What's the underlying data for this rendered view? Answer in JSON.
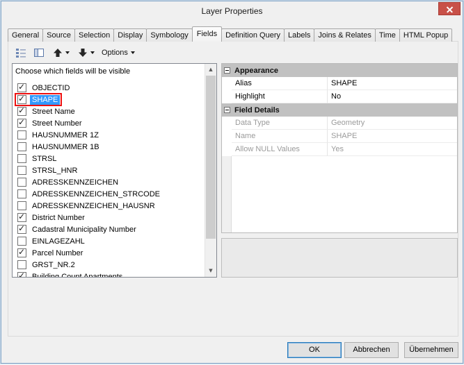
{
  "window": {
    "title": "Layer Properties"
  },
  "colors": {
    "selection_highlight": "#3399ff",
    "annotation_box": "#ee1111",
    "close_button": "#c85048",
    "section_header_bg": "#c1c1c1"
  },
  "tabs": [
    {
      "label": "General",
      "active": false
    },
    {
      "label": "Source",
      "active": false
    },
    {
      "label": "Selection",
      "active": false
    },
    {
      "label": "Display",
      "active": false
    },
    {
      "label": "Symbology",
      "active": false
    },
    {
      "label": "Fields",
      "active": true
    },
    {
      "label": "Definition Query",
      "active": false
    },
    {
      "label": "Labels",
      "active": false
    },
    {
      "label": "Joins & Relates",
      "active": false
    },
    {
      "label": "Time",
      "active": false
    },
    {
      "label": "HTML Popup",
      "active": false
    }
  ],
  "toolbar": {
    "icons": [
      "field-list-icon",
      "field-panel-icon",
      "move-up-icon",
      "move-down-icon"
    ],
    "options_label": "Options"
  },
  "fields_panel": {
    "header": "Choose which fields will be visible",
    "items": [
      {
        "label": "OBJECTID",
        "checked": true,
        "selected": false
      },
      {
        "label": "SHAPE",
        "checked": true,
        "selected": true,
        "annotated": true
      },
      {
        "label": "Street Name",
        "checked": true,
        "selected": false
      },
      {
        "label": "Street Number",
        "checked": true,
        "selected": false
      },
      {
        "label": "HAUSNUMMER 1Z",
        "checked": false,
        "selected": false
      },
      {
        "label": "HAUSNUMMER 1B",
        "checked": false,
        "selected": false
      },
      {
        "label": "STRSL",
        "checked": false,
        "selected": false
      },
      {
        "label": "STRSL_HNR",
        "checked": false,
        "selected": false
      },
      {
        "label": "ADRESSKENNZEICHEN",
        "checked": false,
        "selected": false
      },
      {
        "label": "ADRESSKENNZEICHEN_STRCODE",
        "checked": false,
        "selected": false
      },
      {
        "label": "ADRESSKENNZEICHEN_HAUSNR",
        "checked": false,
        "selected": false
      },
      {
        "label": "District Number",
        "checked": true,
        "selected": false
      },
      {
        "label": "Cadastral Municipality Number",
        "checked": true,
        "selected": false
      },
      {
        "label": "EINLAGEZAHL",
        "checked": false,
        "selected": false
      },
      {
        "label": "Parcel Number",
        "checked": true,
        "selected": false
      },
      {
        "label": "GRST_NR.2",
        "checked": false,
        "selected": false
      },
      {
        "label": "Building Count Apartments",
        "checked": true,
        "selected": false,
        "clipped": true
      }
    ]
  },
  "property_grid": {
    "sections": [
      {
        "header": "Appearance",
        "rows": [
          {
            "name": "Alias",
            "value": "SHAPE",
            "editable": true
          },
          {
            "name": "Highlight",
            "value": "No",
            "editable": true
          }
        ]
      },
      {
        "header": "Field Details",
        "rows": [
          {
            "name": "Data Type",
            "value": "Geometry",
            "editable": false
          },
          {
            "name": "Name",
            "value": "SHAPE",
            "editable": false
          },
          {
            "name": "Allow NULL Values",
            "value": "Yes",
            "editable": false
          }
        ]
      }
    ]
  },
  "buttons": {
    "ok": "OK",
    "cancel": "Abbrechen",
    "apply": "Übernehmen"
  }
}
